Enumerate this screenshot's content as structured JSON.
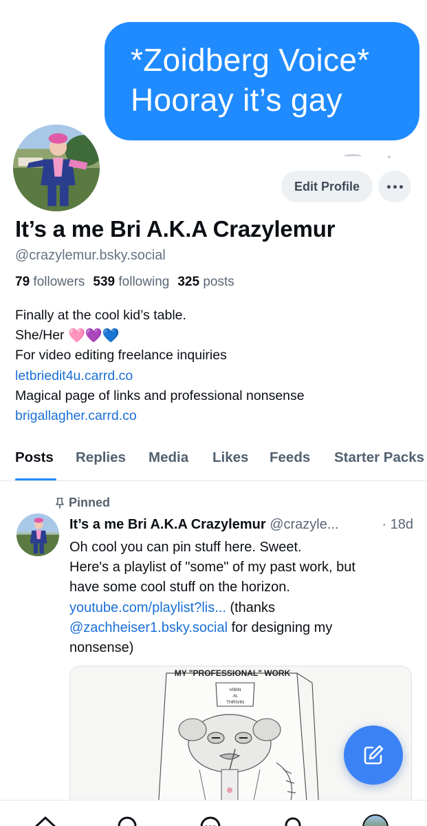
{
  "banner": {
    "bubble_line1": "*Zoidberg Voice*",
    "bubble_line2": "Hooray it’s gay",
    "bubble_color": "#1f8bff"
  },
  "profile": {
    "edit_button": "Edit Profile",
    "more_button_icon": "ellipsis-icon",
    "display_name": "It’s a me Bri A.K.A Crazylemur",
    "handle": "@crazylemur.bsky.social",
    "stats": {
      "followers_count": "79",
      "followers_label": "followers",
      "following_count": "539",
      "following_label": "following",
      "posts_count": "325",
      "posts_label": "posts"
    },
    "bio": {
      "line1": "Finally at the cool kid’s table.",
      "line2_text": "She/Her",
      "line2_emoji": "🩷💜💙",
      "line3": "For video editing freelance inquiries",
      "link1": "letbriedit4u.carrd.co",
      "line5": "Magical page of links and professional nonsense",
      "link2": "brigallagher.carrd.co"
    }
  },
  "tabs": [
    {
      "label": "Posts",
      "active": true
    },
    {
      "label": "Replies"
    },
    {
      "label": "Media"
    },
    {
      "label": "Likes"
    },
    {
      "label": "Feeds"
    },
    {
      "label": "Starter Packs"
    }
  ],
  "pinned_post": {
    "pinned_label": "Pinned",
    "author_name": "It’s a me Bri A.K.A Crazylemur",
    "author_handle": "@crazyle...",
    "time": "· 18d",
    "text_line1": "Oh cool you can pin stuff here. Sweet.",
    "text_line2": "Here's a playlist of \"some\" of my past work, but",
    "text_line3": "have some cool stuff on the horizon.",
    "link_youtube": "youtube.com/playlist?lis...",
    "text_thanks": " (thanks",
    "mention": "@zachheiser1.bsky.social",
    "text_designing": " for designing my",
    "text_last": "nonsense)",
    "embed": {
      "title": "MY \"PROFESSIONAL\" WORK",
      "sign_lines": [
        "VIBIN",
        "-N-",
        "THRIVIN"
      ]
    }
  },
  "fab": {
    "icon": "compose-icon",
    "color": "#3b82f6"
  },
  "bottom_nav": [
    {
      "icon": "home-icon"
    },
    {
      "icon": "search-icon"
    },
    {
      "icon": "chat-icon"
    },
    {
      "icon": "notifications-icon"
    },
    {
      "icon": "profile-avatar"
    }
  ],
  "colors": {
    "link": "#1a6fd6",
    "accent": "#1f8bff",
    "muted_text": "#667282"
  }
}
